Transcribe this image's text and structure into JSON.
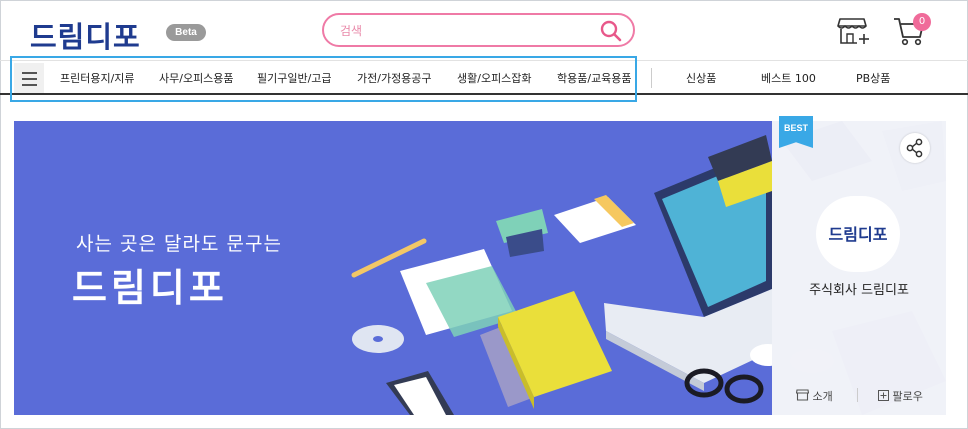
{
  "header": {
    "logo_text": "드림디포",
    "beta_label": "Beta",
    "search_placeholder": "검색",
    "cart_count": "0"
  },
  "nav": {
    "categories": [
      "프린터용지/지류",
      "사무/오피스용품",
      "필기구일반/고급",
      "가전/가정용공구",
      "생활/오피스잡화",
      "학용품/교육용품"
    ],
    "specials": [
      "신상품",
      "베스트 100",
      "PB상품"
    ]
  },
  "banner": {
    "tagline": "사는 곳은 달라도 문구는",
    "brand": "드림디포"
  },
  "seller_card": {
    "badge": "BEST",
    "logo_text": "드림디포",
    "company_name": "주식회사 드림디포",
    "intro_label": "소개",
    "follow_label": "팔로우"
  },
  "colors": {
    "brand_navy": "#1f3b8f",
    "search_pink": "#ef7aa6",
    "banner_blue": "#5a6cd8",
    "highlight_blue": "#39a8e6",
    "badge_pink": "#f06b9a"
  }
}
